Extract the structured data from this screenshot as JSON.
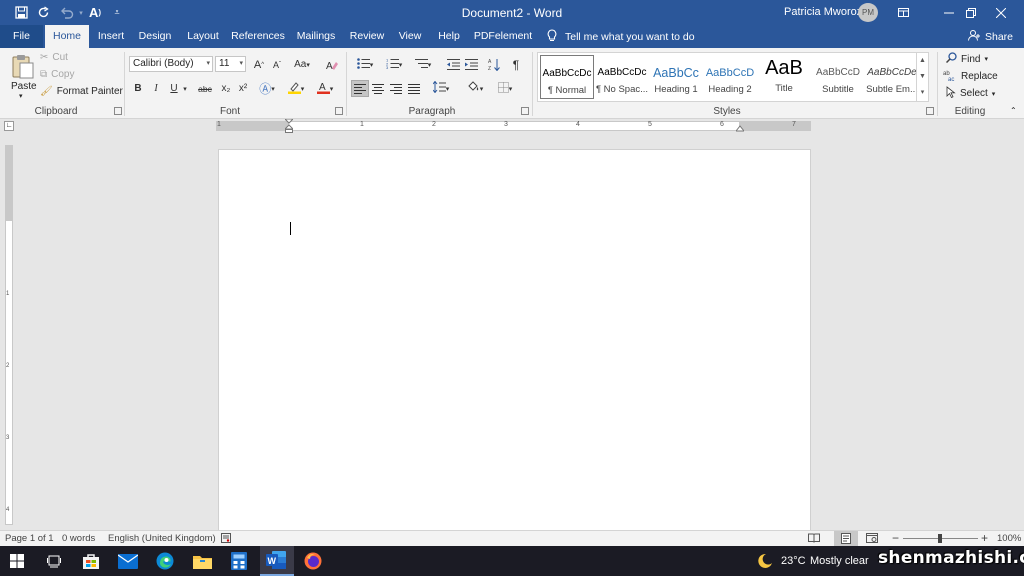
{
  "titlebar": {
    "doc_title": "Document2  -  Word",
    "user_name": "Patricia Mworozi",
    "avatar_initials": "PM",
    "quick_access": [
      "save-icon",
      "autosave-refresh-icon",
      "undo-icon",
      "read-aloud-icon",
      "customize-qat-icon"
    ],
    "window_buttons": [
      "ribbon-display-icon",
      "minimize-icon",
      "restore-icon",
      "close-icon"
    ]
  },
  "tabs": [
    "File",
    "Home",
    "Insert",
    "Design",
    "Layout",
    "References",
    "Mailings",
    "Review",
    "View",
    "Help",
    "PDFelement"
  ],
  "active_tab": "Home",
  "tell_me": "Tell me what you want to do",
  "share": "Share",
  "ribbon": {
    "clipboard": {
      "label": "Clipboard",
      "paste": "Paste",
      "cut": "Cut",
      "copy": "Copy",
      "format_painter": "Format Painter"
    },
    "font": {
      "label": "Font",
      "font_name": "Calibri (Body)",
      "font_size": "11",
      "bold": "B",
      "italic": "I",
      "underline": "U",
      "strikethrough": "abc",
      "subscript": "x₂",
      "superscript": "x²",
      "change_case": "Aa",
      "grow": "A",
      "shrink": "A"
    },
    "paragraph": {
      "label": "Paragraph",
      "show_marks": "¶"
    },
    "styles": {
      "label": "Styles",
      "items": [
        {
          "sample": "AaBbCcDc",
          "name": "¶ Normal"
        },
        {
          "sample": "AaBbCcDc",
          "name": "¶ No Spac..."
        },
        {
          "sample": "AaBbCc",
          "name": "Heading 1"
        },
        {
          "sample": "AaBbCcD",
          "name": "Heading 2"
        },
        {
          "sample": "AaB",
          "name": "Title"
        },
        {
          "sample": "AaBbCcD",
          "name": "Subtitle"
        },
        {
          "sample": "AaBbCcDe",
          "name": "Subtle Em..."
        }
      ]
    },
    "editing": {
      "label": "Editing",
      "find": "Find",
      "replace": "Replace",
      "select": "Select"
    }
  },
  "ruler": {
    "h_numbers": [
      "1",
      "1",
      "2",
      "3",
      "4",
      "5",
      "6",
      "7"
    ],
    "v_numbers": [
      "1",
      "2",
      "3",
      "4"
    ]
  },
  "statusbar": {
    "page": "Page 1 of 1",
    "words": "0 words",
    "language": "English (United Kingdom)",
    "zoom": "100%",
    "zoom_minus": "−",
    "zoom_plus": "+"
  },
  "taskbar": {
    "weather_temp": "23°C",
    "weather_desc": "Mostly clear",
    "watermark": "shenmazhishi.com"
  },
  "colors": {
    "word_blue": "#2b579a",
    "ribbon_bg": "#f3f3f3",
    "canvas_bg": "#e6e6e6",
    "taskbar_bg": "#1b1b24"
  }
}
